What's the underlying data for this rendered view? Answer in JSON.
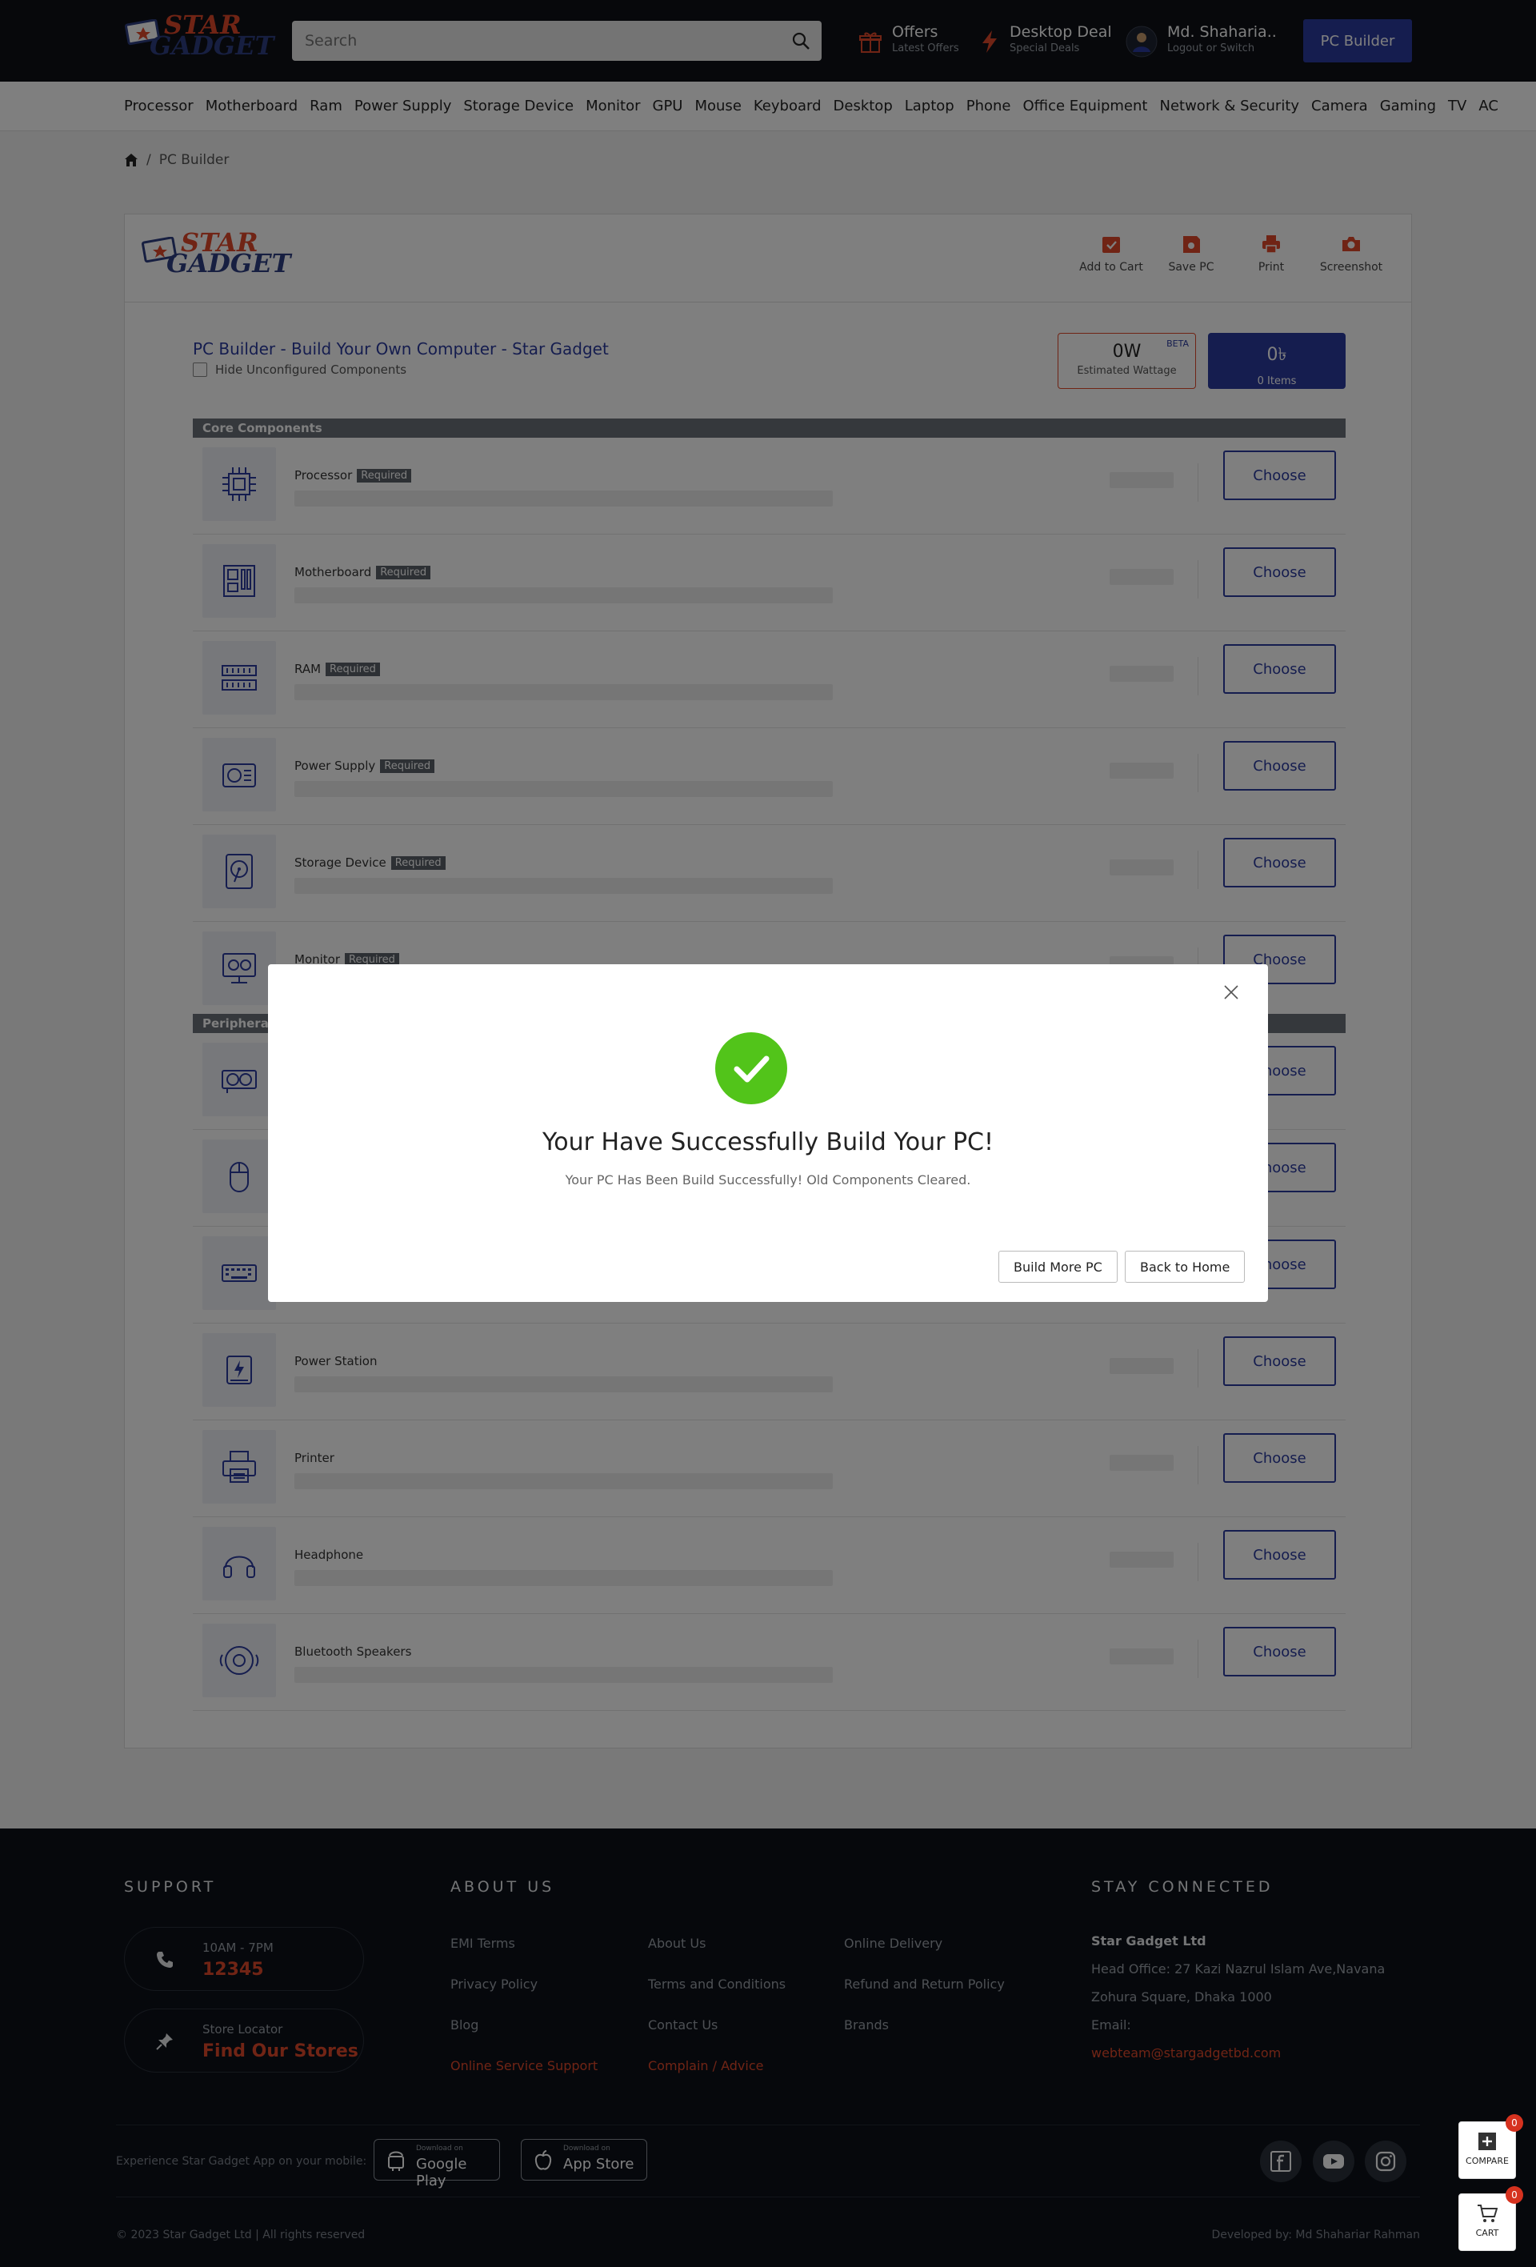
{
  "header": {
    "logo_top": "STAR",
    "logo_bottom": "GADGET",
    "search_placeholder": "Search",
    "offers": {
      "title": "Offers",
      "sub": "Latest Offers"
    },
    "deal": {
      "title": "Desktop Deal",
      "sub": "Special Deals"
    },
    "user": {
      "title": "Md. Shaharia..",
      "sub": "Logout or Switch"
    },
    "pc_builder_btn": "PC Builder"
  },
  "nav": [
    "Processor",
    "Motherboard",
    "Ram",
    "Power Supply",
    "Storage Device",
    "Monitor",
    "GPU",
    "Mouse",
    "Keyboard",
    "Desktop",
    "Laptop",
    "Phone",
    "Office Equipment",
    "Network & Security",
    "Camera",
    "Gaming",
    "TV",
    "AC"
  ],
  "breadcrumb": {
    "sep": "/",
    "current": "PC Builder"
  },
  "builder": {
    "tools": [
      {
        "label": "Add to Cart",
        "icon": "cart-check-icon"
      },
      {
        "label": "Save PC",
        "icon": "save-icon"
      },
      {
        "label": "Print",
        "icon": "printer-icon"
      },
      {
        "label": "Screenshot",
        "icon": "camera-icon"
      }
    ],
    "title": "PC Builder - Build Your Own Computer - Star Gadget",
    "hide_label": "Hide Unconfigured Components",
    "wattage": {
      "value": "0W",
      "label": "Estimated Wattage",
      "badge": "BETA"
    },
    "total": {
      "value": "0৳",
      "label": "0 Items"
    },
    "choose_label": "Choose",
    "required_label": "Required",
    "sections": [
      {
        "title": "Core Components",
        "items": [
          {
            "name": "Processor",
            "required": true,
            "icon": "cpu-icon"
          },
          {
            "name": "Motherboard",
            "required": true,
            "icon": "motherboard-icon"
          },
          {
            "name": "RAM",
            "required": true,
            "icon": "ram-icon"
          },
          {
            "name": "Power Supply",
            "required": true,
            "icon": "power-supply-icon"
          },
          {
            "name": "Storage Device",
            "required": true,
            "icon": "hdd-icon"
          },
          {
            "name": "Monitor",
            "required": true,
            "icon": "monitor-icon"
          }
        ]
      },
      {
        "title": "Peripherals",
        "items": [
          {
            "name": "",
            "required": false,
            "icon": "gpu-icon"
          },
          {
            "name": "",
            "required": false,
            "icon": "mouse-icon"
          },
          {
            "name": "",
            "required": false,
            "icon": "keyboard-icon"
          },
          {
            "name": "Power Station",
            "required": false,
            "icon": "power-station-icon"
          },
          {
            "name": "Printer",
            "required": false,
            "icon": "printer-device-icon"
          },
          {
            "name": "Headphone",
            "required": false,
            "icon": "headphone-icon"
          },
          {
            "name": "Bluetooth Speakers",
            "required": false,
            "icon": "speaker-icon"
          }
        ]
      }
    ]
  },
  "modal": {
    "title": "Your Have Successfully Build Your PC!",
    "message": "Your PC Has Been Build Successfully! Old Components Cleared.",
    "build_more": "Build More PC",
    "back_home": "Back to Home"
  },
  "footer": {
    "support_title": "SUPPORT",
    "about_title": "ABOUT US",
    "stay_title": "STAY CONNECTED",
    "phone": {
      "hours": "10AM - 7PM",
      "number": "12345"
    },
    "store": {
      "label": "Store Locator",
      "link": "Find Our Stores"
    },
    "links_col1": [
      "EMI Terms",
      "Privacy Policy",
      "Blog",
      "Online Service Support"
    ],
    "links_col2": [
      "About Us",
      "Terms and Conditions",
      "Contact Us",
      "Complain / Advice"
    ],
    "links_col3": [
      "Online Delivery",
      "Refund and Return Policy",
      "Brands"
    ],
    "company": "Star Gadget Ltd",
    "address1": "Head Office: 27 Kazi Nazrul Islam Ave,Navana",
    "address2": "Zohura Square, Dhaka 1000",
    "email_label": "Email:",
    "email": "webteam@stargadgetbd.com",
    "app_text": "Experience Star Gadget App on your mobile:",
    "google": {
      "small": "Download on",
      "big": "Google Play"
    },
    "apple": {
      "small": "Download on",
      "big": "App Store"
    },
    "copyright": "© 2023 Star Gadget Ltd | All rights reserved",
    "developer": "Developed by: Md Shahariar Rahman"
  },
  "floating": {
    "compare": {
      "label": "COMPARE",
      "count": "0"
    },
    "cart": {
      "label": "CART",
      "count": "0"
    }
  },
  "colors": {
    "brand_blue": "#2b3a9e",
    "brand_red": "#e0492a",
    "success_green": "#52c41a",
    "header_bg": "#0e1117"
  }
}
